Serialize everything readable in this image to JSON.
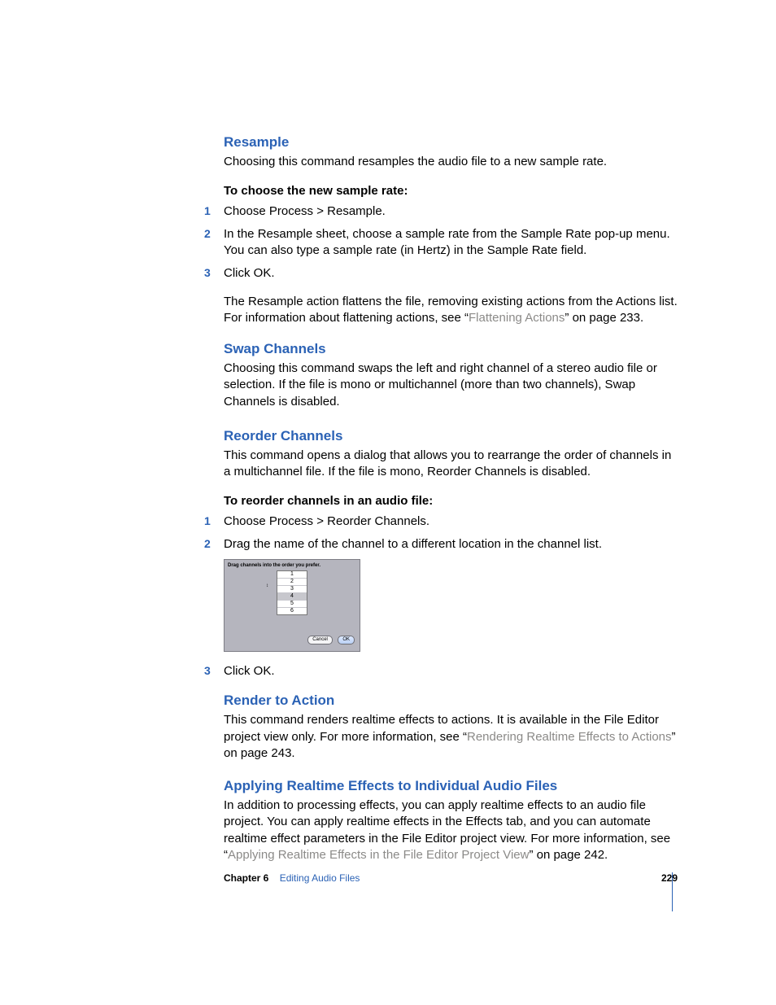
{
  "sections": {
    "resample": {
      "heading": "Resample",
      "intro": "Choosing this command resamples the audio file to a new sample rate.",
      "task_heading": "To choose the new sample rate:",
      "steps": {
        "s1": "Choose Process > Resample.",
        "s2": "In the Resample sheet, choose a sample rate from the Sample Rate pop-up menu. You can also type a sample rate (in Hertz) in the Sample Rate field.",
        "s3": "Click OK."
      },
      "note_prefix": "The Resample action flattens the file, removing existing actions from the Actions list. For information about flattening actions, see “",
      "note_link": "Flattening Actions",
      "note_suffix": "” on page 233."
    },
    "swap": {
      "heading": "Swap Channels",
      "body": "Choosing this command swaps the left and right channel of a stereo audio file or selection. If the file is mono or multichannel (more than two channels), Swap Channels is disabled."
    },
    "reorder": {
      "heading": "Reorder Channels",
      "body": "This command opens a dialog that allows you to rearrange the order of channels in a multichannel file. If the file is mono, Reorder Channels is disabled.",
      "task_heading": "To reorder channels in an audio file:",
      "steps": {
        "s1": "Choose Process > Reorder Channels.",
        "s2": "Drag the name of the channel to a different location in the channel list.",
        "s3": "Click OK."
      },
      "dialog": {
        "title": "Drag channels into the order you prefer.",
        "rows": {
          "r1": "1",
          "r2": "2",
          "r3": "3",
          "r4": "4",
          "r5": "5",
          "r6": "6"
        },
        "cancel": "Cancel",
        "ok": "OK"
      }
    },
    "render": {
      "heading": "Render to Action",
      "body_prefix": "This command renders realtime effects to actions. It is available in the File Editor project view only. For more information, see “",
      "body_link": "Rendering Realtime Effects to Actions",
      "body_suffix": "” on page 243."
    },
    "applying": {
      "heading": "Applying Realtime Effects to Individual Audio Files",
      "body_prefix": "In addition to processing effects, you can apply realtime effects to an audio file project. You can apply realtime effects in the Effects tab, and you can automate realtime effect parameters in the File Editor project view. For more information, see “",
      "body_link": "Applying Realtime Effects in the File Editor Project View",
      "body_suffix": "” on page 242."
    }
  },
  "footer": {
    "chapter_label": "Chapter 6",
    "chapter_title": "Editing Audio Files",
    "page_number": "229"
  }
}
